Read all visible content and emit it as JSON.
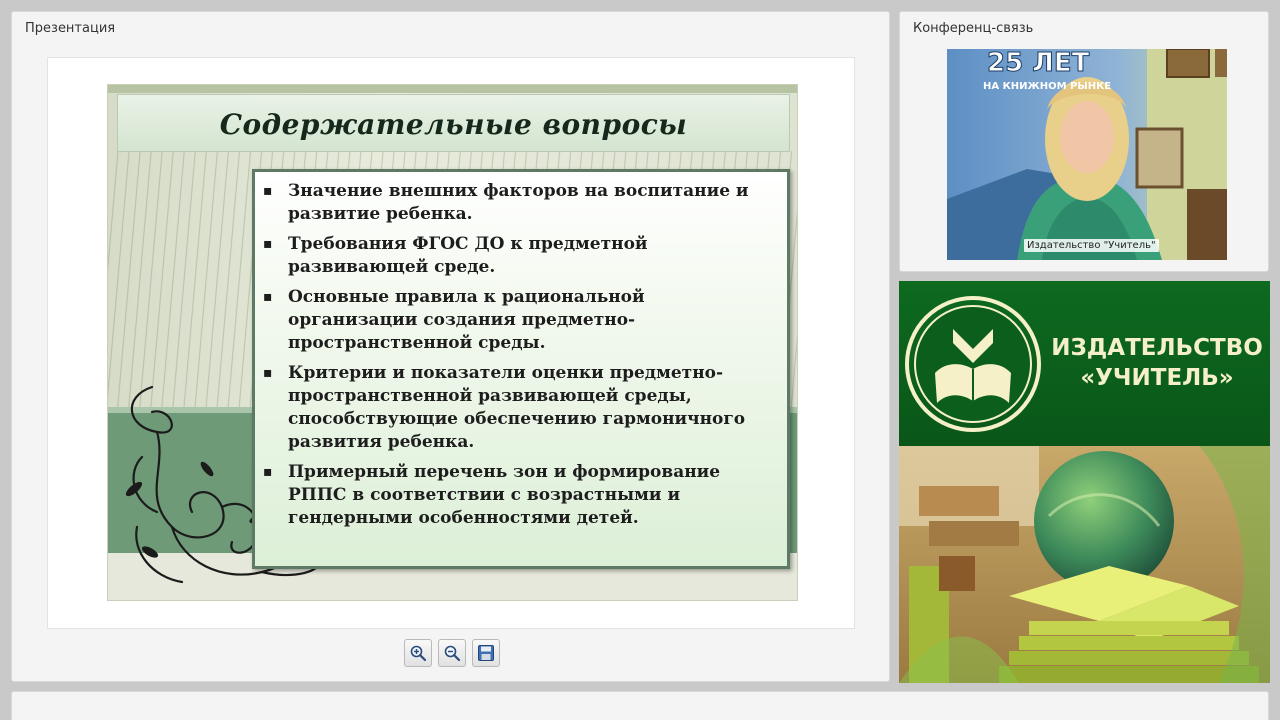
{
  "presentation": {
    "title": "Презентация",
    "slide": {
      "title": "Содержательные вопросы",
      "bullets": [
        "Значение внешних факторов на воспитание и развитие ребенка.",
        "Требования ФГОС ДО к предметной развивающей среде.",
        "Основные правила к рациональной организации создания предметно-пространственной среды.",
        "Критерии и показатели оценки предметно-пространственной развивающей среды, способствующие обеспечению гармоничного развития ребенка.",
        "Примерный перечень зон и формирование РППС  в соответствии с возрастными и гендерными особенностями детей."
      ]
    },
    "toolbar": {
      "zoom_in_icon": "zoom-in-icon",
      "zoom_out_icon": "zoom-out-icon",
      "save_icon": "floppy-disk-icon"
    }
  },
  "conference": {
    "title": "Конференц-связь",
    "banner_text": "25 ЛЕТ",
    "banner_sub": "НА КНИЖНОМ РЫНКЕ",
    "video_caption": "Издательство \"Учитель\""
  },
  "publisher": {
    "name_line1": "ИЗДАТЕЛЬСТВО",
    "name_line2": "«УЧИТЕЛЬ»",
    "colors": {
      "green": "#0d6a1f",
      "gold": "#f5f0c8"
    }
  }
}
